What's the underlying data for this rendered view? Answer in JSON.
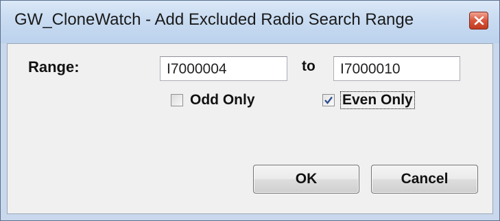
{
  "window": {
    "title": "GW_CloneWatch - Add Excluded Radio Search Range",
    "close_icon": "close-icon"
  },
  "form": {
    "range_label": "Range:",
    "range_from": "I7000004",
    "to_label": "to",
    "range_to": "I7000010",
    "odd_only_label": "Odd Only",
    "odd_only_checked": false,
    "even_only_label": "Even Only",
    "even_only_checked": true
  },
  "buttons": {
    "ok_label": "OK",
    "cancel_label": "Cancel"
  },
  "colors": {
    "titlebar": "#c8dbf1",
    "close_button": "#d8563c",
    "dialog_background": "#f0f0f0",
    "check_mark": "#2c4f8c"
  }
}
